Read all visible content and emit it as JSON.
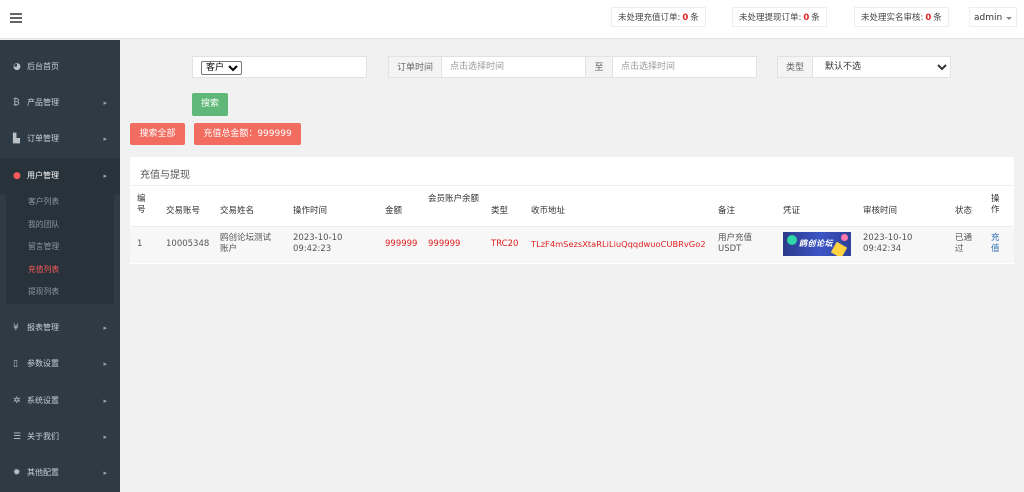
{
  "topbar": {
    "pending_recharge_label": "未处理充值订单:",
    "pending_recharge_count": "0",
    "pending_withdraw_label": "未处理提现订单:",
    "pending_withdraw_count": "0",
    "pending_realname_label": "未处理实名审核:",
    "pending_realname_count": "0",
    "unit": "条",
    "user": "admin"
  },
  "sidebar": {
    "items": [
      {
        "label": "后台首页",
        "icon": "dashboard-icon"
      },
      {
        "label": "产品管理",
        "icon": "bitcoin-icon"
      },
      {
        "label": "订单管理",
        "icon": "document-icon"
      },
      {
        "label": "用户管理",
        "icon": "user-icon"
      },
      {
        "label": "报表管理",
        "icon": "yen-icon"
      },
      {
        "label": "参数设置",
        "icon": "file-icon"
      },
      {
        "label": "系统设置",
        "icon": "gears-icon"
      },
      {
        "label": "关于我们",
        "icon": "list-icon"
      },
      {
        "label": "其他配置",
        "icon": "gear-icon"
      }
    ],
    "submenu": [
      "客户列表",
      "我的团队",
      "留言管理",
      "充值列表",
      "提现列表"
    ]
  },
  "filter": {
    "customer_option": "客户",
    "order_time_label": "订单时间",
    "start_placeholder": "点击选择时间",
    "to_label": "至",
    "end_placeholder": "点击选择时间",
    "type_label": "类型",
    "type_value": "默认不选",
    "search_button": "搜索",
    "search_all_button": "搜索全部",
    "total_button": "充值总金额：999999"
  },
  "panel": {
    "title": "充值与提现",
    "columns": [
      "编号",
      "交易账号",
      "交易姓名",
      "操作时间",
      "金额",
      "会员账户余额",
      "类型",
      "收币地址",
      "备注",
      "凭证",
      "审核时间",
      "状态",
      "操作"
    ],
    "row": {
      "id": "1",
      "account": "10005348",
      "name": "鸥创论坛测试账户",
      "op_time": "2023-10-10 09:42:23",
      "amount": "999999",
      "balance": "999999",
      "type": "TRC20",
      "address": "TLzF4mSezsXtaRLiLiuQqqdwuoCUBRvGo2",
      "remark": "用户充值USDT",
      "voucher_text": "鸥创论坛",
      "audit_time": "2023-10-10 09:42:34",
      "status": "已通过",
      "action": "充值"
    }
  }
}
